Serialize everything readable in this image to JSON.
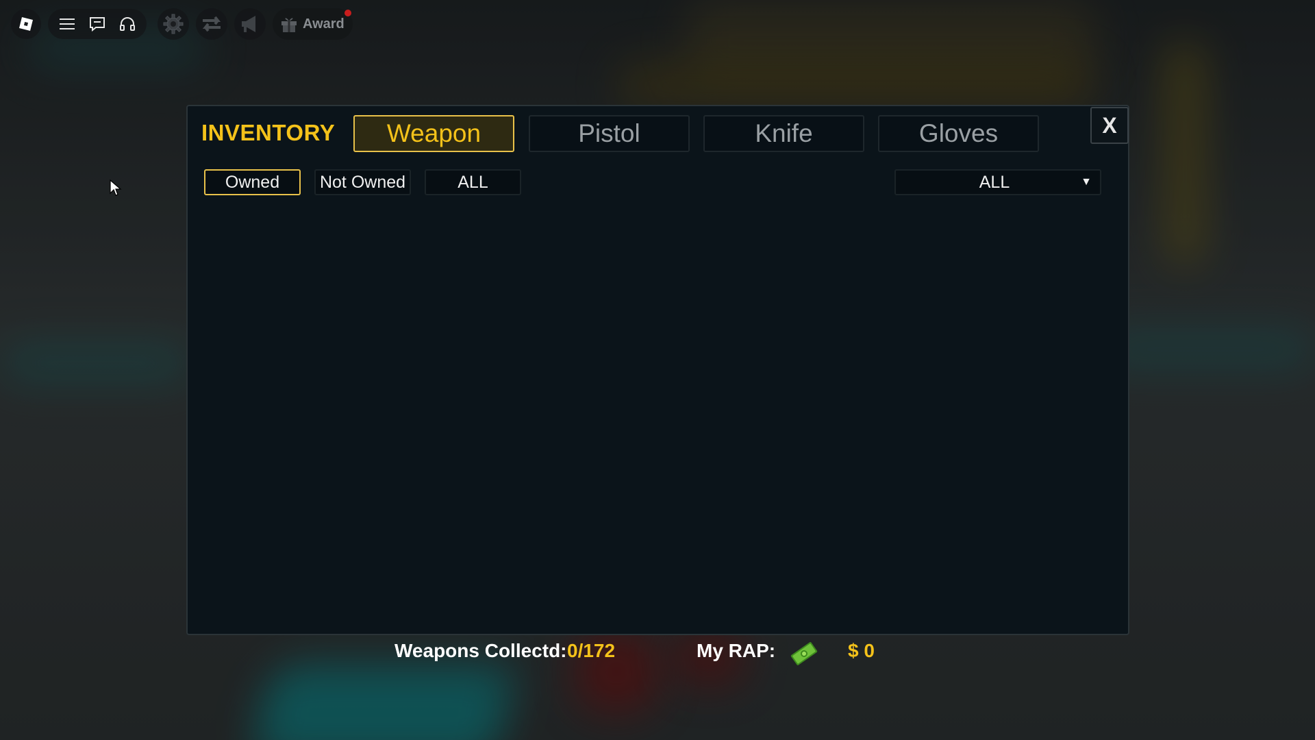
{
  "topbar": {
    "icons": [
      "roblox-logo-icon",
      "menu-icon",
      "chat-icon",
      "headset-icon",
      "gear-icon",
      "swap-icon",
      "megaphone-icon",
      "gift-icon"
    ],
    "award_label": "Award"
  },
  "inventory": {
    "title": "INVENTORY",
    "tabs": [
      {
        "label": "Weapon",
        "active": true
      },
      {
        "label": "Pistol",
        "active": false
      },
      {
        "label": "Knife",
        "active": false
      },
      {
        "label": "Gloves",
        "active": false
      }
    ],
    "close_label": "X",
    "filters": [
      {
        "label": "Owned",
        "active": true
      },
      {
        "label": "Not Owned",
        "active": false
      },
      {
        "label": "ALL",
        "active": false
      }
    ],
    "dropdown": {
      "value": "ALL",
      "arrow": "▼"
    }
  },
  "stats": {
    "weapons_label": "Weapons Collectd:",
    "weapons_value": "0/172",
    "rap_label": "My RAP:",
    "rap_value": "$ 0"
  },
  "colors": {
    "accent": "#f4c21a",
    "panel_bg": "#0b141a",
    "active_tab_border": "#e8c14a"
  }
}
